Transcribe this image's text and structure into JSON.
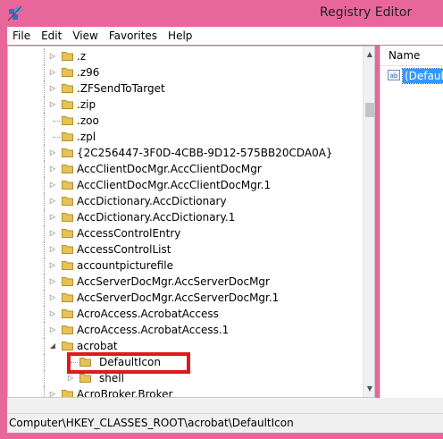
{
  "window": {
    "title": "Registry Editor",
    "icon": "registry-editor-icon"
  },
  "menu": [
    "File",
    "Edit",
    "View",
    "Favorites",
    "Help"
  ],
  "tree": {
    "items": [
      {
        "label": ".z",
        "expander": "collapsed"
      },
      {
        "label": ".z96",
        "expander": "collapsed"
      },
      {
        "label": ".ZFSendToTarget",
        "expander": "collapsed"
      },
      {
        "label": ".zip",
        "expander": "collapsed"
      },
      {
        "label": ".zoo",
        "expander": "none"
      },
      {
        "label": ".zpl",
        "expander": "none"
      },
      {
        "label": "{2C256447-3F0D-4CBB-9D12-575BB20CDA0A}",
        "expander": "collapsed"
      },
      {
        "label": "AccClientDocMgr.AccClientDocMgr",
        "expander": "collapsed"
      },
      {
        "label": "AccClientDocMgr.AccClientDocMgr.1",
        "expander": "collapsed"
      },
      {
        "label": "AccDictionary.AccDictionary",
        "expander": "collapsed"
      },
      {
        "label": "AccDictionary.AccDictionary.1",
        "expander": "collapsed"
      },
      {
        "label": "AccessControlEntry",
        "expander": "collapsed"
      },
      {
        "label": "AccessControlList",
        "expander": "collapsed"
      },
      {
        "label": "accountpicturefile",
        "expander": "collapsed"
      },
      {
        "label": "AccServerDocMgr.AccServerDocMgr",
        "expander": "collapsed"
      },
      {
        "label": "AccServerDocMgr.AccServerDocMgr.1",
        "expander": "collapsed"
      },
      {
        "label": "AcroAccess.AcrobatAccess",
        "expander": "collapsed"
      },
      {
        "label": "AcroAccess.AcrobatAccess.1",
        "expander": "collapsed"
      },
      {
        "label": "acrobat",
        "expander": "expanded"
      },
      {
        "label": "DefaultIcon",
        "expander": "none",
        "child": true,
        "selected": true
      },
      {
        "label": "shell",
        "expander": "collapsed",
        "child": true
      },
      {
        "label": "AcroBroker.Broker",
        "expander": "collapsed"
      }
    ]
  },
  "values": {
    "column_header": "Name",
    "rows": [
      {
        "name": "(Default)",
        "icon": "string-value-ab-icon"
      }
    ]
  },
  "status": {
    "path": "Computer\\HKEY_CLASSES_ROOT\\acrobat\\DefaultIcon"
  },
  "colors": {
    "window_frame": "#e8679a",
    "selection": "#3399ff",
    "highlight_box": "#e0191d",
    "folder": "#e8c15a"
  }
}
